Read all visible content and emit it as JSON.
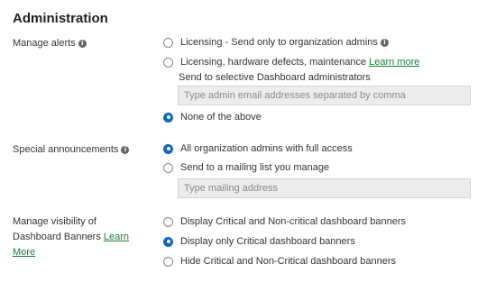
{
  "title": "Administration",
  "info_glyph": "i",
  "manage_alerts": {
    "label": "Manage alerts",
    "option_licensing": "Licensing - Send only to organization admins",
    "option_all": "Licensing, hardware defects, maintenance",
    "learn_more": "Learn more",
    "selective_label": "Send to selective Dashboard administrators",
    "email_placeholder": "Type admin email addresses separated by comma",
    "option_none": "None of the above"
  },
  "special_announcements": {
    "label": "Special announcements",
    "option_all_admins": "All organization admins with full access",
    "option_mailing_list": "Send to a mailing list you manage",
    "mailing_placeholder": "Type mailing address"
  },
  "dashboard_banners": {
    "label_line1": "Manage visibility of",
    "label_line2": "Dashboard Banners",
    "learn_more_1": "Learn",
    "learn_more_2": "More",
    "option_display_all": "Display Critical and Non-critical dashboard banners",
    "option_critical_only": "Display only Critical dashboard banners",
    "option_hide_all": "Hide Critical and Non-Critical dashboard banners"
  }
}
